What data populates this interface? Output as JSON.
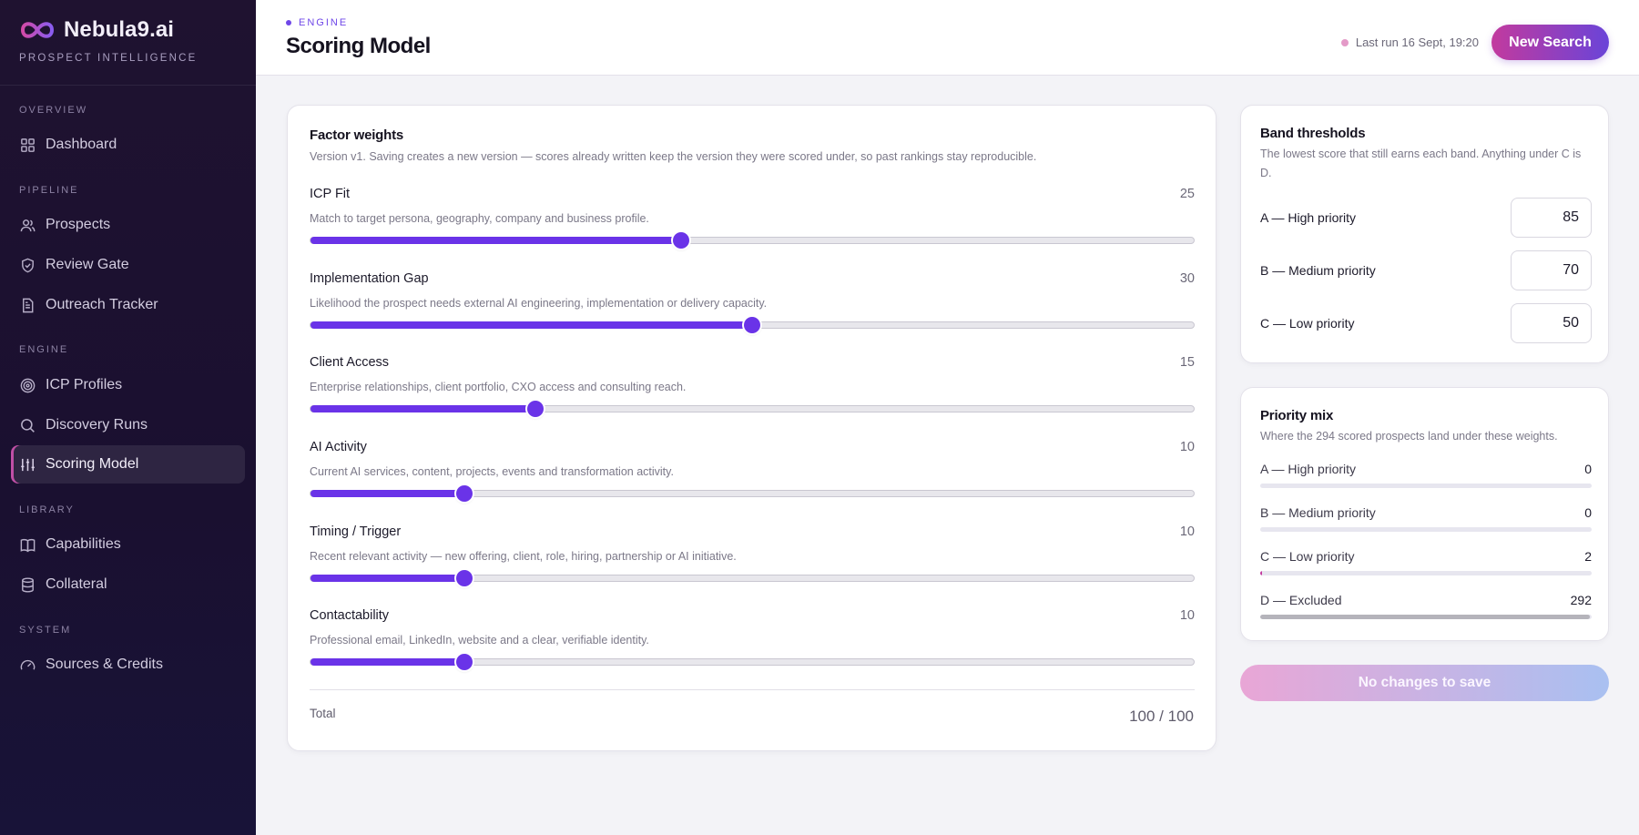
{
  "brand": {
    "name": "Nebula9.ai",
    "subtitle": "PROSPECT INTELLIGENCE"
  },
  "sidebar": {
    "sections": [
      {
        "label": "OVERVIEW",
        "items": [
          {
            "label": "Dashboard",
            "icon": "grid-icon"
          }
        ]
      },
      {
        "label": "PIPELINE",
        "items": [
          {
            "label": "Prospects",
            "icon": "users-icon"
          },
          {
            "label": "Review Gate",
            "icon": "shield-check-icon"
          },
          {
            "label": "Outreach Tracker",
            "icon": "document-icon"
          }
        ]
      },
      {
        "label": "ENGINE",
        "items": [
          {
            "label": "ICP Profiles",
            "icon": "target-icon"
          },
          {
            "label": "Discovery Runs",
            "icon": "search-icon"
          },
          {
            "label": "Scoring Model",
            "icon": "sliders-icon",
            "active": true
          }
        ]
      },
      {
        "label": "LIBRARY",
        "items": [
          {
            "label": "Capabilities",
            "icon": "book-icon"
          },
          {
            "label": "Collateral",
            "icon": "database-icon"
          }
        ]
      },
      {
        "label": "SYSTEM",
        "items": [
          {
            "label": "Sources & Credits",
            "icon": "gauge-icon"
          }
        ]
      }
    ]
  },
  "header": {
    "breadcrumb": "ENGINE",
    "title": "Scoring Model",
    "last_run": "Last run 16 Sept, 19:20",
    "new_search": "New Search"
  },
  "factor_weights": {
    "title": "Factor weights",
    "description": "Version v1. Saving creates a new version — scores already written keep the version they were scored under, so past rankings stay reproducible.",
    "factors": [
      {
        "name": "ICP Fit",
        "value": "25",
        "weight_fraction": 0.42,
        "description": "Match to target persona, geography, company and business profile."
      },
      {
        "name": "Implementation Gap",
        "value": "30",
        "weight_fraction": 0.5,
        "description": "Likelihood the prospect needs external AI engineering, implementation or delivery capacity."
      },
      {
        "name": "Client Access",
        "value": "15",
        "weight_fraction": 0.255,
        "description": "Enterprise relationships, client portfolio, CXO access and consulting reach."
      },
      {
        "name": "AI Activity",
        "value": "10",
        "weight_fraction": 0.174,
        "description": "Current AI services, content, projects, events and transformation activity."
      },
      {
        "name": "Timing / Trigger",
        "value": "10",
        "weight_fraction": 0.174,
        "description": "Recent relevant activity — new offering, client, role, hiring, partnership or AI initiative."
      },
      {
        "name": "Contactability",
        "value": "10",
        "weight_fraction": 0.174,
        "description": "Professional email, LinkedIn, website and a clear, verifiable identity."
      }
    ],
    "total_label": "Total",
    "total_value": "100 / 100"
  },
  "band_thresholds": {
    "title": "Band thresholds",
    "description": "The lowest score that still earns each band. Anything under C is D.",
    "bands": [
      {
        "label": "A — High priority",
        "value": "85"
      },
      {
        "label": "B — Medium priority",
        "value": "70"
      },
      {
        "label": "C — Low priority",
        "value": "50"
      }
    ]
  },
  "priority_mix": {
    "title": "Priority mix",
    "description": "Where the 294 scored prospects land under these weights.",
    "rows": [
      {
        "label": "A — High priority",
        "value": "0",
        "count": 0,
        "color": "#6a33e8"
      },
      {
        "label": "B — Medium priority",
        "value": "0",
        "count": 0,
        "color": "#6a33e8"
      },
      {
        "label": "C — Low priority",
        "value": "2",
        "count": 2,
        "color": "#c23a9e"
      },
      {
        "label": "D — Excluded",
        "value": "292",
        "count": 292,
        "color": "#b5b4bb"
      }
    ],
    "total_count": 294
  },
  "save_button": "No changes to save",
  "colors": {
    "accent": "#6a33e8",
    "brand_pink": "#c23a9e",
    "sidebar_bg": "#1f1230"
  }
}
